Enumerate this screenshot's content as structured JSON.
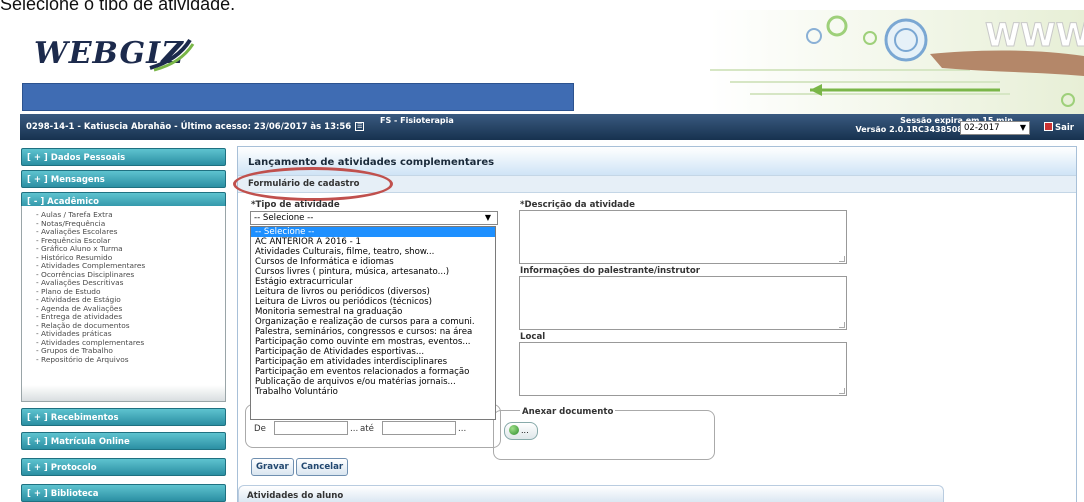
{
  "caption": "Selecione o tipo de atividade.",
  "header": {
    "logo_text": "WEBGIZ",
    "brand_colors": {
      "banner": "#3f6cb3",
      "userbar": "#17324f",
      "sidebar": "#2b8fa3",
      "highlight": "#c0504d"
    }
  },
  "userbar": {
    "user_info": "0298-14-1 - Katiuscia Abrahão - Último acesso: 23/06/2017 às 13:56",
    "course": "FS - Fisioterapia",
    "session_expires": "Sessão expira em 15 min.",
    "version": "Versão 2.0.1RC3438508 26/10/2016",
    "period_value": "02-2017",
    "exit_label": "Sair"
  },
  "sidebar": {
    "personal": "[ + ] Dados Pessoais",
    "messages": "[ + ] Mensagens",
    "academic": "[ - ] Acadêmico",
    "academic_items": [
      "- Aulas / Tarefa Extra",
      "- Notas/Frequência",
      "- Avaliações Escolares",
      "- Frequência Escolar",
      "- Gráfico Aluno x Turma",
      "- Histórico Resumido",
      "- Atividades Complementares",
      "- Ocorrências Disciplinares",
      "- Avaliações Descritivas",
      "- Plano de Estudo",
      "- Atividades de Estágio",
      "- Agenda de Avaliações",
      "- Entrega de atividades",
      "- Relação de documentos",
      "- Atividades práticas",
      "- Atividades complementares",
      "- Grupos de Trabalho",
      "- Repositório de Arquivos"
    ],
    "receipts": "[ + ] Recebimentos",
    "enrollment": "[ + ] Matrícula Online",
    "protocol": "[ + ] Protocolo",
    "library": "[ + ] Biblioteca"
  },
  "main": {
    "title": "Lançamento de atividades complementares",
    "form_title": "Formulário de cadastro",
    "activity_type_label": "*Tipo de atividade",
    "activity_type_value": "-- Selecione --",
    "activity_options": [
      "-- Selecione --",
      "AC ANTERIOR A 2016 - 1",
      "Atividades Culturais, filme, teatro, show...",
      "Cursos de Informática e idiomas",
      "Cursos livres ( pintura, música, artesanato...)",
      "Estágio extracurricular",
      "Leitura de livros ou periódicos (diversos)",
      "Leitura de Livros ou periódicos (técnicos)",
      "Monitoria semestral na graduação",
      "Organização e realização de cursos para a comuni.",
      "Palestra, seminários, congressos e cursos: na área",
      "Participação como ouvinte em mostras, eventos...",
      "Participação de Atividades esportivas...",
      "Participação em atividades interdisciplinares",
      "Participação em eventos relacionados a formação",
      "Publicação de arquivos e/ou matérias jornais...",
      "Trabalho Voluntário"
    ],
    "description_label": "*Descrição da atividade",
    "speaker_label": "Informações do palestrante/instrutor",
    "location_label": "Local",
    "date_from_label": "De",
    "date_to_label": "até",
    "date_dots": "...",
    "attach_label": "Anexar documento",
    "attach_button_dots": "...",
    "save_label": "Gravar",
    "cancel_label": "Cancelar",
    "students_section": "Atividades do aluno"
  }
}
